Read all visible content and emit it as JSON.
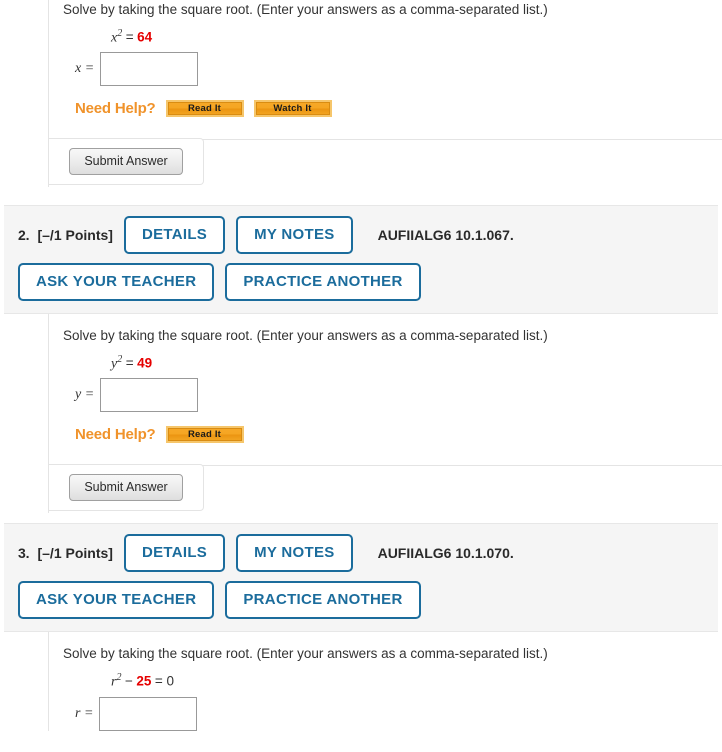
{
  "questions": [
    {
      "number": "",
      "points": "",
      "reference": "",
      "partial_top": true,
      "prompt": "Solve by taking the square root. (Enter your answers as a comma-separated list.)",
      "equation": {
        "variable": "x",
        "exponent": "2",
        "operator": "=",
        "value": "64",
        "tail": ""
      },
      "answer_label": "x =",
      "answer_value": "",
      "help_label": "Need Help?",
      "help_buttons": [
        "Read It",
        "Watch It"
      ],
      "submit_label": "Submit Answer",
      "header_buttons_row1": [],
      "header_buttons_row2": []
    },
    {
      "number": "2.",
      "points": "[–/1 Points]",
      "reference": "AUFIIALG6 10.1.067.",
      "partial_top": false,
      "prompt": "Solve by taking the square root. (Enter your answers as a comma-separated list.)",
      "equation": {
        "variable": "y",
        "exponent": "2",
        "operator": "=",
        "value": "49",
        "tail": ""
      },
      "answer_label": "y =",
      "answer_value": "",
      "help_label": "Need Help?",
      "help_buttons": [
        "Read It"
      ],
      "submit_label": "Submit Answer",
      "header_buttons_row1": [
        "DETAILS",
        "MY NOTES"
      ],
      "header_buttons_row2": [
        "ASK YOUR TEACHER",
        "PRACTICE ANOTHER"
      ]
    },
    {
      "number": "3.",
      "points": "[–/1 Points]",
      "reference": "AUFIIALG6 10.1.070.",
      "partial_top": false,
      "prompt": "Solve by taking the square root. (Enter your answers as a comma-separated list.)",
      "equation": {
        "variable": "r",
        "exponent": "2",
        "operator": "−",
        "value": "25",
        "tail": "= 0"
      },
      "answer_label": "r =",
      "answer_value": "",
      "help_label": "",
      "help_buttons": [],
      "submit_label": "",
      "header_buttons_row1": [
        "DETAILS",
        "MY NOTES"
      ],
      "header_buttons_row2": [
        "ASK YOUR TEACHER",
        "PRACTICE ANOTHER"
      ]
    }
  ],
  "colors": {
    "button_blue": "#1b6c9c",
    "help_orange": "#f0932b",
    "value_red": "#e60000",
    "header_gray": "#f5f5f5"
  }
}
